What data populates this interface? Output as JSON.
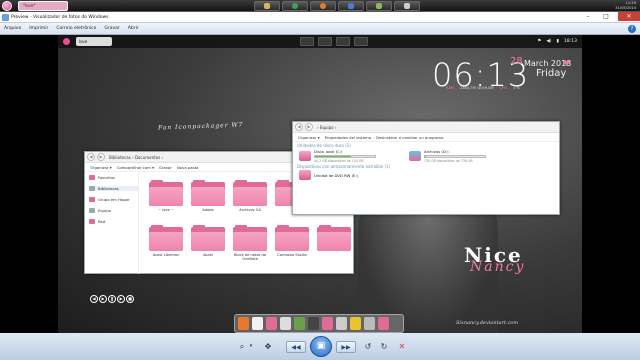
{
  "taskbar": {
    "tab_label": "*love*",
    "tray_time": "11:20",
    "tray_date": "31/05/2014"
  },
  "viewer": {
    "title": "Preview - Visualizador de fotos do Windows",
    "menu": [
      "Arquivo",
      "Imprimir",
      "Correio eletrônico",
      "Gravar",
      "Abrir"
    ],
    "help": "?"
  },
  "wallpaper": {
    "inner_tab": "love",
    "tray_time": "18:13",
    "clock": {
      "time": "06:13",
      "seconds": "28",
      "date": "March 2013",
      "day": "Friday",
      "ram_label": "RAM",
      "ram_value": "2364,7M /4059,8M",
      "cpu_label": "CPU",
      "cpu_value": "1 %"
    },
    "caption": "Fan Iconpackager W7",
    "nice": "Nice",
    "nancy": "Nancy",
    "credit": "Sixnancy.deviantart.com"
  },
  "libraries_window": {
    "address": "Bibliotecas  ›  Documentos  ›",
    "commands": [
      "Organizar ▾",
      "Compartilhar com ▾",
      "Gravar",
      "Nova pasta"
    ],
    "sidebar": [
      {
        "label": "Favoritos",
        "color": "#e06a98"
      },
      {
        "label": "Bibliotecas",
        "color": "#9aa"
      },
      {
        "label": "Grupo em Hogar",
        "color": "#e06a98"
      },
      {
        "label": "Equipo",
        "color": "#9aa"
      },
      {
        "label": "Red",
        "color": "#e06a98"
      }
    ],
    "folders": [
      "~ love ~",
      "Adobe",
      "Archivos G4",
      "",
      "",
      "Avast Librerian",
      "Avast",
      "Block de notas de OneNote",
      "Camtasia Studio",
      ""
    ]
  },
  "computer_window": {
    "address": "›  Equipo  ›",
    "commands": [
      "Organizar ▾",
      "Propiedades del sistema",
      "Desinstalar o cambiar un programa"
    ],
    "section_drives": "Unidades de disco duro (2)",
    "drives": [
      {
        "name": "Disco local (C:)",
        "free": "40,2 GB disponibles de 100 GB",
        "fill": 0.6
      },
      {
        "name": "Archivos (D:)",
        "free": "730 GB disponibles de 738 GB",
        "fill": 0.02
      }
    ],
    "section_removable": "Dispositivos con almacenamiento extraíble (1)",
    "dvd": "Unidad de DVD RW (E:)"
  },
  "colors": {
    "accent_pink": "#f07aa8",
    "folder_pink": "#ef84ad",
    "close_red": "#c7413a"
  }
}
